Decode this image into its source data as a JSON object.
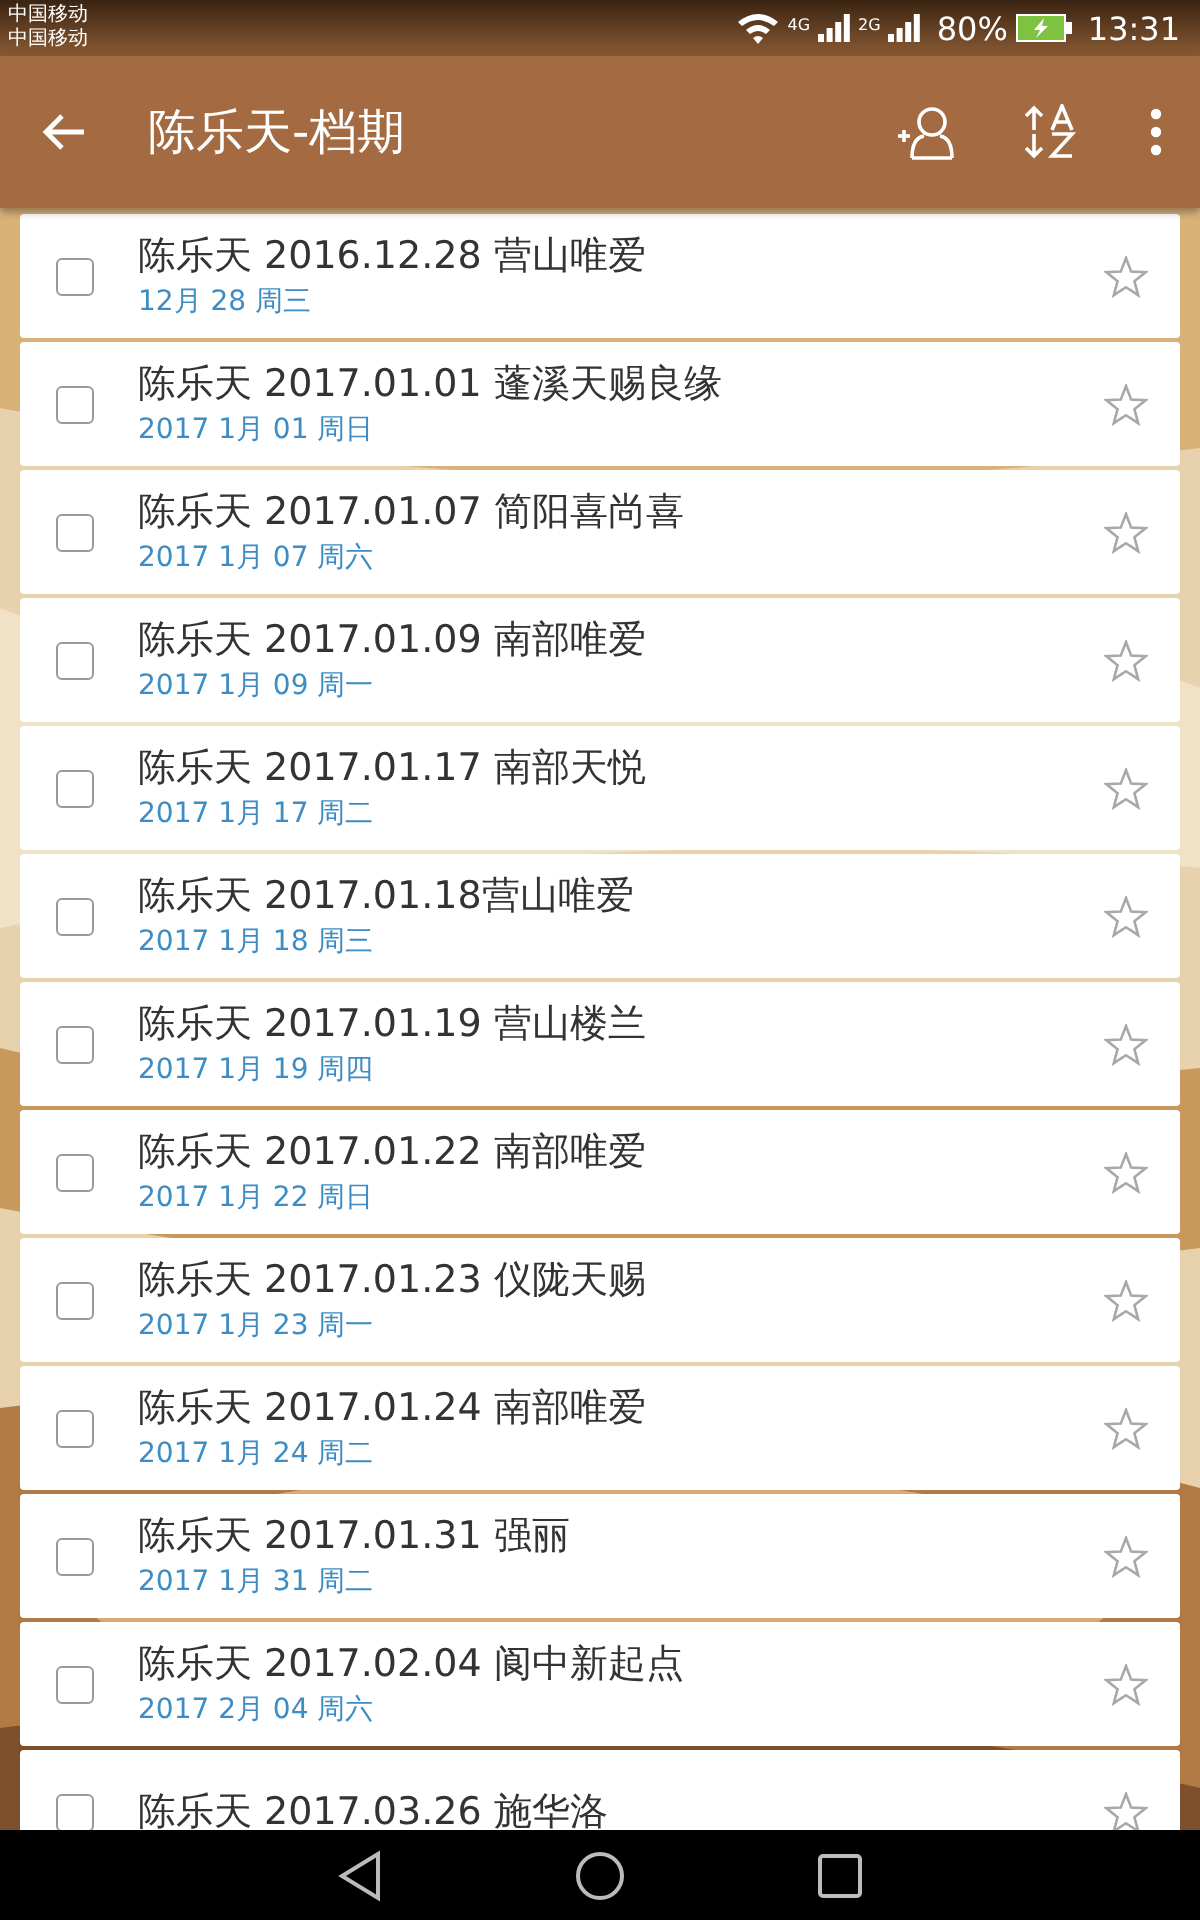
{
  "status_bar": {
    "carriers": [
      "中国移动",
      "中国移动"
    ],
    "network_1": "4G",
    "network_2": "2G",
    "battery": "80%",
    "time": "13:31"
  },
  "toolbar": {
    "title": "陈乐天-档期"
  },
  "events": [
    {
      "title": "陈乐天 2016.12.28 营山唯爱",
      "date": "12月 28 周三",
      "checked": false,
      "starred": false
    },
    {
      "title": "陈乐天 2017.01.01 蓬溪天赐良缘",
      "date": "2017 1月 01 周日",
      "checked": false,
      "starred": false
    },
    {
      "title": "陈乐天 2017.01.07 简阳喜尚喜",
      "date": "2017 1月 07 周六",
      "checked": false,
      "starred": false
    },
    {
      "title": "陈乐天 2017.01.09 南部唯爱",
      "date": "2017 1月 09 周一",
      "checked": false,
      "starred": false
    },
    {
      "title": "陈乐天 2017.01.17 南部天悦",
      "date": "2017 1月 17 周二",
      "checked": false,
      "starred": false
    },
    {
      "title": "陈乐天 2017.01.18营山唯爱",
      "date": "2017 1月 18 周三",
      "checked": false,
      "starred": false
    },
    {
      "title": "陈乐天 2017.01.19 营山楼兰",
      "date": "2017 1月 19 周四",
      "checked": false,
      "starred": false
    },
    {
      "title": "陈乐天 2017.01.22 南部唯爱",
      "date": "2017 1月 22 周日",
      "checked": false,
      "starred": false
    },
    {
      "title": "陈乐天 2017.01.23 仪陇天赐",
      "date": "2017 1月 23 周一",
      "checked": false,
      "starred": false
    },
    {
      "title": "陈乐天 2017.01.24 南部唯爱",
      "date": "2017 1月 24 周二",
      "checked": false,
      "starred": false
    },
    {
      "title": "陈乐天 2017.01.31 强丽",
      "date": "2017 1月 31 周二",
      "checked": false,
      "starred": false
    },
    {
      "title": "陈乐天 2017.02.04 阆中新起点",
      "date": "2017 2月 04 周六",
      "checked": false,
      "starred": false
    },
    {
      "title": "陈乐天 2017.03.26 施华洛",
      "checked": false,
      "starred": false
    }
  ]
}
